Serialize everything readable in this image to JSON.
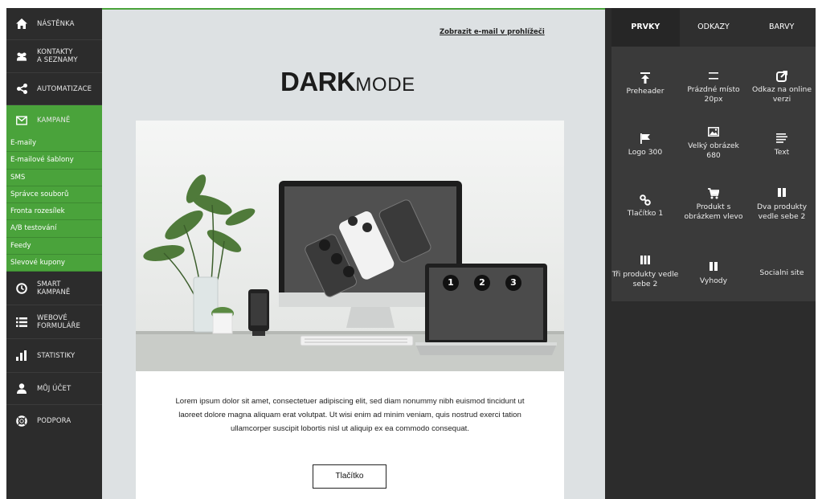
{
  "sidebar": {
    "items": [
      {
        "label": "NÁSTĚNKA",
        "icon": "home-icon"
      },
      {
        "label": "KONTAKTY",
        "label2": "A SEZNAMY",
        "icon": "users-icon"
      },
      {
        "label": "AUTOMATIZACE",
        "icon": "share-icon"
      },
      {
        "label": "KAMPANĚ",
        "icon": "envelope-icon"
      },
      {
        "label": "SMART",
        "label2": "KAMPANĚ",
        "icon": "clock-icon"
      },
      {
        "label": "WEBOVÉ",
        "label2": "FORMULÁŘE",
        "icon": "list-icon"
      },
      {
        "label": "STATISTIKY",
        "icon": "bar-chart-icon"
      },
      {
        "label": "MŮJ ÚČET",
        "icon": "user-icon"
      },
      {
        "label": "PODPORA",
        "icon": "lifebuoy-icon"
      }
    ],
    "campaign_sub": [
      "E-maily",
      "E-mailové šablony",
      "SMS",
      "Správce souborů",
      "Fronta rozesílek",
      "A/B testování",
      "Feedy",
      "Slevové kupony"
    ]
  },
  "email": {
    "view_in_browser": "Zobrazit e-mail v prohlížeči",
    "logo_main": "DARK",
    "logo_small": "MODE",
    "body_text": "Lorem ipsum dolor sit amet, consectetuer adipiscing elit, sed diam nonummy nibh euismod tincidunt ut laoreet dolore magna aliquam erat volutpat. Ut wisi enim ad minim veniam, quis nostrud exerci tation ullamcorper suscipit lobortis nisl ut aliquip ex ea commodo consequat.",
    "button_label": "Tlačítko",
    "hero_steps": [
      "1",
      "2",
      "3"
    ]
  },
  "panel": {
    "tabs": [
      "PRVKY",
      "ODKAZY",
      "BARVY"
    ],
    "active_tab": "PRVKY",
    "blocks": [
      {
        "label": "Preheader",
        "icon": "arrow-up-bar-icon"
      },
      {
        "label": "Prázdné místo 20px",
        "icon": "equals-icon"
      },
      {
        "label": "Odkaz na online verzi",
        "icon": "external-link-icon"
      },
      {
        "label": "Logo 300",
        "icon": "flag-icon"
      },
      {
        "label": "Velký obrázek 680",
        "icon": "image-icon"
      },
      {
        "label": "Text",
        "icon": "text-lines-icon"
      },
      {
        "label": "Tlačítko 1",
        "icon": "link-icon"
      },
      {
        "label": "Produkt s obrázkem vlevo",
        "icon": "cart-icon"
      },
      {
        "label": "Dva produkty vedle sebe 2",
        "icon": "two-columns-icon"
      },
      {
        "label": "Tři produkty vedle sebe 2",
        "icon": "three-columns-icon"
      },
      {
        "label": "Vyhody",
        "icon": "two-columns-icon"
      },
      {
        "label": "Socialni site",
        "icon": ""
      }
    ]
  },
  "colors": {
    "accent": "#4aa33b",
    "sidebar": "#2c2c2c",
    "panel": "#3a3a3a",
    "canvas": "#dde1e3"
  }
}
